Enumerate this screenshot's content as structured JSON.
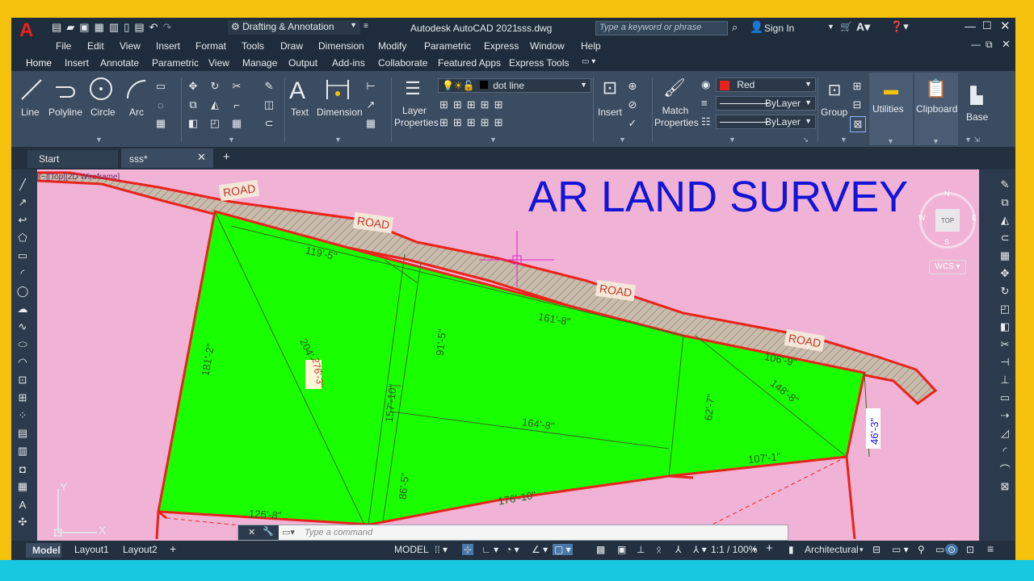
{
  "app": {
    "title": "Autodesk AutoCAD 2021",
    "filename": "sss.dwg",
    "workspace": "Drafting & Annotation",
    "search_placeholder": "Type a keyword or phrase",
    "signin_label": "Sign In"
  },
  "menu": [
    "File",
    "Edit",
    "View",
    "Insert",
    "Format",
    "Tools",
    "Draw",
    "Dimension",
    "Modify",
    "Parametric",
    "Express",
    "Window",
    "Help"
  ],
  "ribbon_tabs": [
    "Home",
    "Insert",
    "Annotate",
    "Parametric",
    "View",
    "Manage",
    "Output",
    "Add-ins",
    "Collaborate",
    "Featured Apps",
    "Express Tools"
  ],
  "draw_tools": {
    "line": "Line",
    "polyline": "Polyline",
    "circle": "Circle",
    "arc": "Arc"
  },
  "annotation": {
    "text": "Text",
    "dimension": "Dimension"
  },
  "layers": {
    "layer_properties": "Layer Properties",
    "current_layer": "dot line"
  },
  "block": {
    "insert": "Insert"
  },
  "properties": {
    "match": "Match Properties",
    "color": "Red",
    "color_hex": "#e8231b",
    "linetype": "ByLayer",
    "lineweight": "ByLayer"
  },
  "groups": {
    "group": "Group",
    "utilities": "Utilities",
    "clipboard": "Clipboard",
    "base": "Base"
  },
  "doc_tabs": [
    "Start",
    "sss*"
  ],
  "viewport_label": "[−][Top][2D Wireframe]",
  "drawing": {
    "title": "AR LAND SURVEY",
    "road_labels": [
      "ROAD",
      "ROAD",
      "ROAD",
      "ROAD"
    ],
    "dimensions": [
      "119'-5\"",
      "161'-8\"",
      "106'-9\"",
      "181'-2\"",
      "204'-10\"",
      "157'-10\"",
      "91'-5\"",
      "164'-8\"",
      "62'-7\"",
      "148'-8\"",
      "46'-3\"",
      "107'-1\"",
      "126'-8\"",
      "86'-5\"",
      "176'-10\"",
      "276'-3\""
    ],
    "colors": {
      "background": "#f0b3d6",
      "parcel": "#1aff00",
      "road": "#c4b7a8",
      "title": "#1414d6",
      "boundary": "#ff2a1a"
    }
  },
  "viewcube": {
    "face": "TOP",
    "n": "N",
    "s": "S",
    "e": "E",
    "w": "W",
    "wcs": "WCS"
  },
  "ucs": {
    "x": "X",
    "y": "Y"
  },
  "command": {
    "placeholder": "Type a command"
  },
  "layout_tabs": [
    "Model",
    "Layout1",
    "Layout2"
  ],
  "status": {
    "model": "MODEL",
    "scale": "1:1 / 100%",
    "units": "Architectural"
  }
}
